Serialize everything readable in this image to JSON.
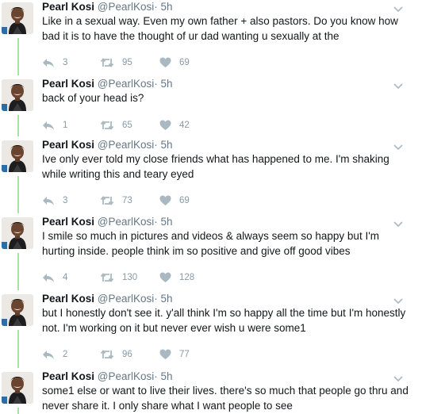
{
  "tweets": [
    {
      "name": "Pearl Kosi",
      "handle": "@PearlKosi",
      "sep": "·",
      "time": "5h",
      "text": "Like in a sexual way. Even my own father + also pastors. Do you know how bad it is to have the thought of ur dad wanting u sexually at the",
      "replies": "3",
      "retweets": "95",
      "likes": "69"
    },
    {
      "name": "Pearl Kosi",
      "handle": "@PearlKosi",
      "sep": "·",
      "time": "5h",
      "text": "back of your head is?",
      "replies": "1",
      "retweets": "65",
      "likes": "42"
    },
    {
      "name": "Pearl Kosi",
      "handle": "@PearlKosi",
      "sep": "·",
      "time": "5h",
      "text": "Ive only ever told my close friends what has happened to me. I'm shaking while writing this and teary eyed",
      "replies": "3",
      "retweets": "73",
      "likes": "69"
    },
    {
      "name": "Pearl Kosi",
      "handle": "@PearlKosi",
      "sep": "·",
      "time": "5h",
      "text": "I smile so much in pictures and videos & always seem so happy but I'm hurting inside. people think im so positive and give off good vibes",
      "replies": "4",
      "retweets": "130",
      "likes": "128"
    },
    {
      "name": "Pearl Kosi",
      "handle": "@PearlKosi",
      "sep": "·",
      "time": "5h",
      "text": "but I honestly don't see it. y'all think I'm so happy all the time but I'm honestly not. I'm working on it but never ever wish u were some1",
      "replies": "2",
      "retweets": "96",
      "likes": "77"
    },
    {
      "name": "Pearl Kosi",
      "handle": "@PearlKosi",
      "sep": "·",
      "time": "5h",
      "text": "some1 else or want to live their lives. there's so much that people go thru and never share it. I only share what I want people to see",
      "replies": "",
      "retweets": "",
      "likes": ""
    }
  ],
  "colors": {
    "thread_line": "#a6e3a1",
    "action_gray": "#aab8c2",
    "name": "#14171a",
    "meta": "#657786"
  },
  "icons": {
    "reply": "reply-icon",
    "retweet": "retweet-icon",
    "like": "heart-icon",
    "menu": "chevron-down-icon",
    "avatar": "profile-photo"
  }
}
